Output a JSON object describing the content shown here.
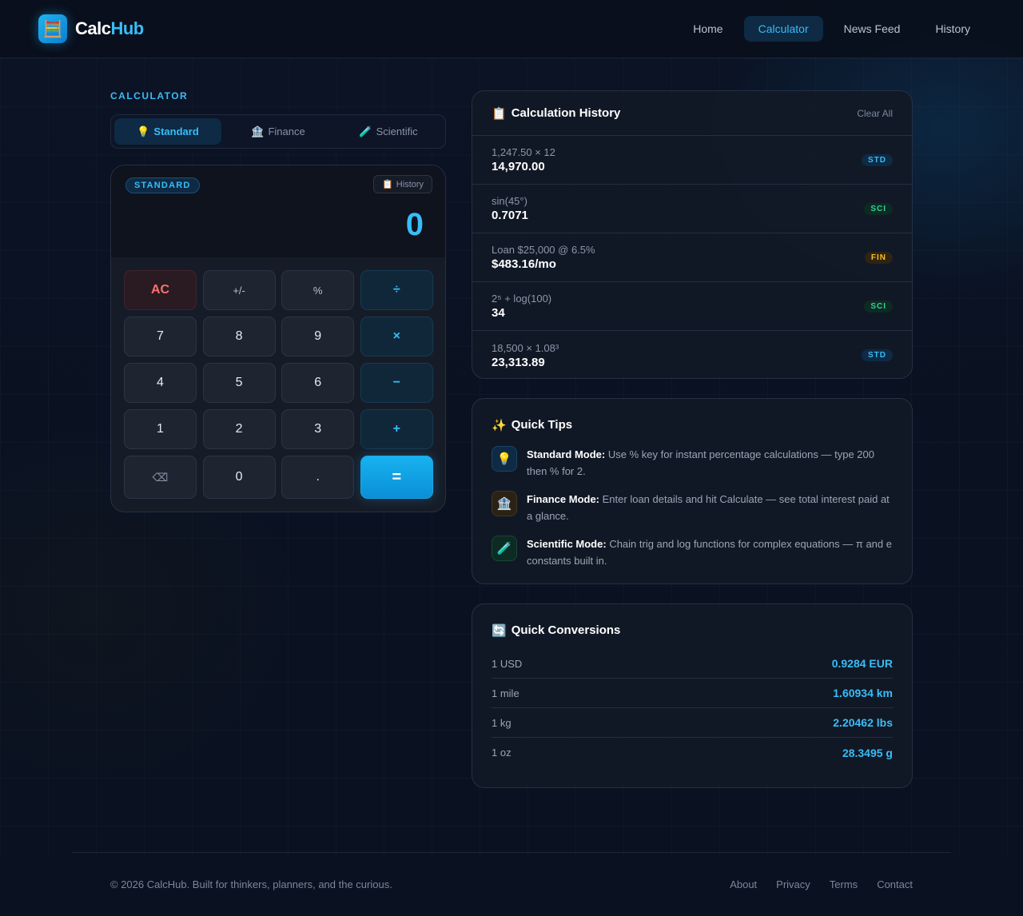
{
  "brand": {
    "name_main": "Calc",
    "name_accent": "Hub",
    "logo_icon": "abacus-icon"
  },
  "nav": {
    "items": [
      "Home",
      "Calculator",
      "News Feed",
      "History"
    ],
    "active": "Calculator"
  },
  "calculator_section": {
    "label": "CALCULATOR",
    "tabs": [
      {
        "icon": "💡",
        "label": "Standard",
        "active": true
      },
      {
        "icon": "🏦",
        "label": "Finance",
        "active": false
      },
      {
        "icon": "🧪",
        "label": "Scientific",
        "active": false
      }
    ]
  },
  "calculator": {
    "mode_badge": "STANDARD",
    "history_button": "History",
    "history_button_icon": "📋",
    "display_value": "0",
    "keys": [
      "AC",
      "+/-",
      "%",
      "÷",
      "7",
      "8",
      "9",
      "×",
      "4",
      "5",
      "6",
      "−",
      "1",
      "2",
      "3",
      "+",
      "⌫",
      "0",
      ".",
      "="
    ]
  },
  "history": {
    "title_icon": "📋",
    "title": "Calculation History",
    "clear_label": "Clear All",
    "rows": [
      {
        "expr": "1,247.50 × 12",
        "result": "14,970.00",
        "tag": "STD"
      },
      {
        "expr": "sin(45°)",
        "result": "0.7071",
        "tag": "SCI"
      },
      {
        "expr": "Loan $25,000 @ 6.5%",
        "result": "$483.16/mo",
        "tag": "FIN"
      },
      {
        "expr": "2⁵ + log(100)",
        "result": "34",
        "tag": "SCI"
      },
      {
        "expr": "18,500 × 1.08³",
        "result": "23,313.89",
        "tag": "STD"
      }
    ]
  },
  "tips": {
    "title_icon": "✨",
    "title": "Quick Tips",
    "items": [
      {
        "icon": "💡",
        "heading": "Standard Mode:",
        "text": "Use % key for instant percentage calculations — type 200 then % for 2."
      },
      {
        "icon": "🏦",
        "heading": "Finance Mode:",
        "text": "Enter loan details and hit Calculate — see total interest paid at a glance."
      },
      {
        "icon": "🧪",
        "heading": "Scientific Mode:",
        "text": "Chain trig and log functions for complex equations — π and e constants built in."
      }
    ]
  },
  "conversions": {
    "title_icon": "🔄",
    "title": "Quick Conversions",
    "rows": [
      {
        "from": "1 USD",
        "to": "0.9284 EUR"
      },
      {
        "from": "1 mile",
        "to": "1.60934 km"
      },
      {
        "from": "1 kg",
        "to": "2.20462 lbs"
      },
      {
        "from": "1 oz",
        "to": "28.3495 g"
      }
    ]
  },
  "footer": {
    "copyright": "© 2026 CalcHub. Built for thinkers, planners, and the curious.",
    "links": [
      "About",
      "Privacy",
      "Terms",
      "Contact"
    ]
  },
  "colors": {
    "accent": "#38bdf8",
    "background": "#0a1120",
    "card": "#121926",
    "danger": "#f87171",
    "success": "#34d399",
    "warning": "#fbbf24"
  }
}
